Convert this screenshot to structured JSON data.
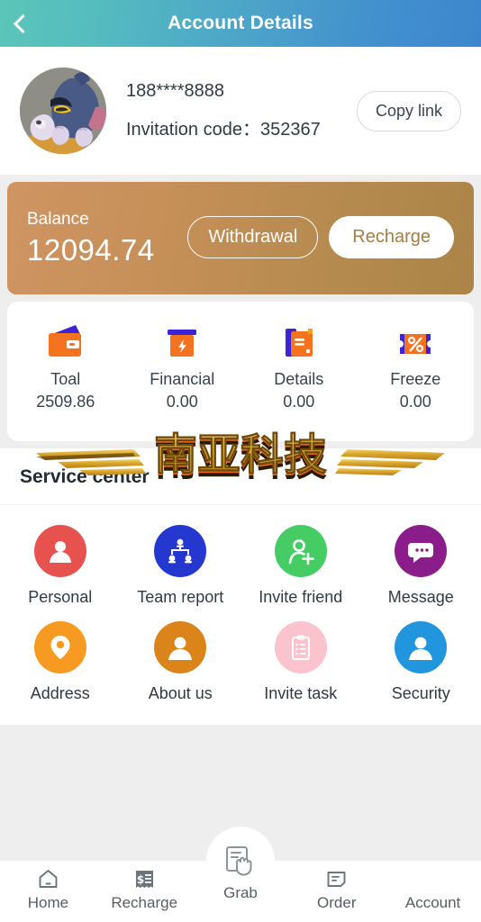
{
  "header": {
    "title": "Account Details",
    "back_icon": "chevron-left-icon",
    "gradient_from": "#5cc5b9",
    "gradient_to": "#3d86cf"
  },
  "profile": {
    "avatar_icon": "cat-avatar",
    "phone": "188****8888",
    "invitation_label": "Invitation code：",
    "invitation_code": "352367",
    "copy_link_label": "Copy link"
  },
  "balance": {
    "label": "Balance",
    "amount": "12094.74",
    "withdrawal_label": "Withdrawal",
    "recharge_label": "Recharge",
    "gradient_from": "#cf9462",
    "gradient_to": "#ab8448"
  },
  "stats": [
    {
      "icon": "wallet-icon",
      "label": "Toal",
      "value": "2509.86"
    },
    {
      "icon": "financial-icon",
      "label": "Financial",
      "value": "0.00"
    },
    {
      "icon": "details-icon",
      "label": "Details",
      "value": "0.00"
    },
    {
      "icon": "coupon-icon",
      "label": "Freeze",
      "value": "0.00"
    }
  ],
  "watermark": {
    "text": "南亚科技",
    "color": "#e3b33c"
  },
  "service": {
    "title": "Service center",
    "items": [
      {
        "icon": "person-icon",
        "label": "Personal",
        "color": "#e7514e"
      },
      {
        "icon": "org-chart-icon",
        "label": "Team report",
        "color": "#2438cf"
      },
      {
        "icon": "person-add-icon",
        "label": "Invite friend",
        "color": "#46cc64"
      },
      {
        "icon": "chat-bubble-icon",
        "label": "Message",
        "color": "#8b1d8b"
      },
      {
        "icon": "map-pin-icon",
        "label": "Address",
        "color": "#f79a21"
      },
      {
        "icon": "user-circle-icon",
        "label": "About us",
        "color": "#da8419"
      },
      {
        "icon": "clipboard-icon",
        "label": "Invite task",
        "color": "#fbc3ce"
      },
      {
        "icon": "shield-user-icon",
        "label": "Security",
        "color": "#2196dd"
      }
    ]
  },
  "bottom_nav": {
    "items": [
      {
        "icon": "home-icon",
        "label": "Home",
        "active": false
      },
      {
        "icon": "receipt-icon",
        "label": "Recharge",
        "active": false
      },
      {
        "icon": "grab-hand-icon",
        "label": "Grab",
        "active": false
      },
      {
        "icon": "order-icon",
        "label": "Order",
        "active": false
      },
      {
        "icon": "none",
        "label": "Account",
        "active": false
      }
    ]
  }
}
